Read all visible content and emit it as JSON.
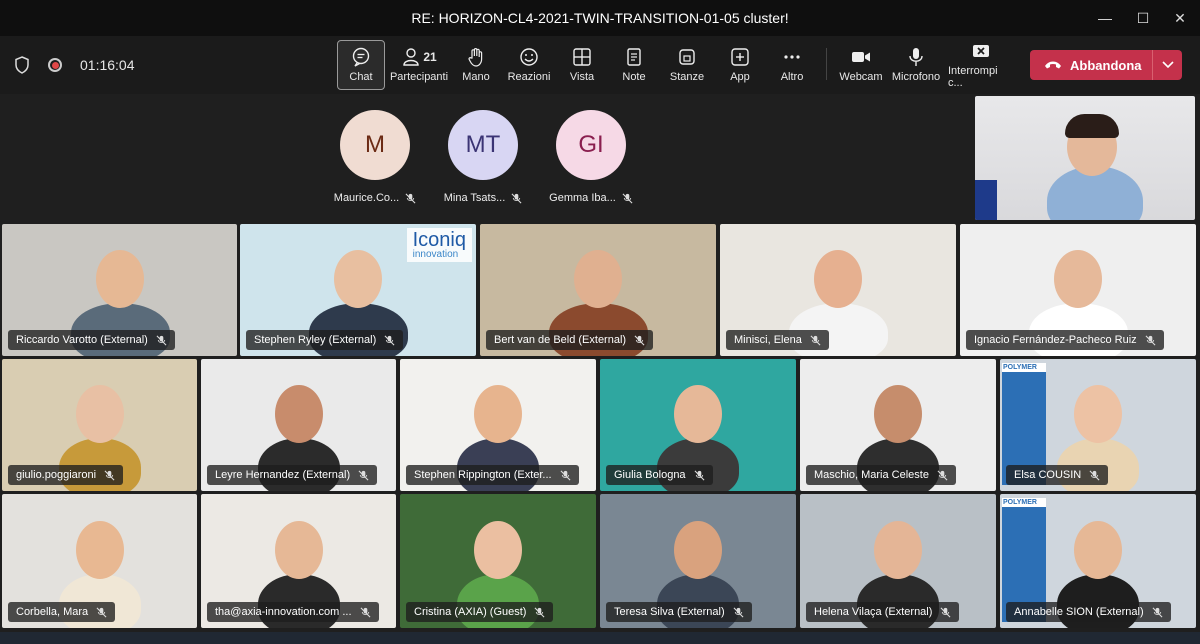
{
  "window": {
    "title": "RE: HORIZON-CL4-2021-TWIN-TRANSITION-01-05 cluster!"
  },
  "toolbar": {
    "timer": "01:16:04",
    "participants_count": "21",
    "buttons": [
      {
        "label": "Chat",
        "icon": "chat-icon"
      },
      {
        "label": "Partecipanti",
        "icon": "people-icon"
      },
      {
        "label": "Mano",
        "icon": "hand-icon"
      },
      {
        "label": "Reazioni",
        "icon": "smile-icon"
      },
      {
        "label": "Vista",
        "icon": "grid-icon"
      },
      {
        "label": "Note",
        "icon": "notes-icon"
      },
      {
        "label": "Stanze",
        "icon": "rooms-icon"
      },
      {
        "label": "App",
        "icon": "plus-icon"
      },
      {
        "label": "Altro",
        "icon": "more-icon"
      },
      {
        "label": "Webcam",
        "icon": "camera-icon"
      },
      {
        "label": "Microfono",
        "icon": "microphone-icon"
      },
      {
        "label": "Interrompi c...",
        "icon": "stop-share-icon"
      }
    ],
    "leave_label": "Abbandona"
  },
  "avatars": [
    {
      "initials": "M",
      "name": "Maurice.Co...",
      "bg": "#f0dcd2",
      "fg": "#6b2a14"
    },
    {
      "initials": "MT",
      "name": "Mina Tsats...",
      "bg": "#d8d6f3",
      "fg": "#3b3474"
    },
    {
      "initials": "GI",
      "name": "Gemma Iba...",
      "bg": "#f6d9e6",
      "fg": "#8a1f4f"
    }
  ],
  "participants": [
    "Riccardo Varotto (External)",
    "Stephen Ryley (External)",
    "Bert van de Beld (External)",
    "Minisci, Elena",
    "Ignacio Fernández-Pacheco Ruiz",
    "giulio.poggiaroni",
    "Leyre Hernandez (External)",
    "Stephen Rippington (Exter...",
    "Giulia Bologna",
    "Maschio, Maria Celeste",
    "Elsa COUSIN",
    "Corbella, Mara",
    "tha@axia-innovation.com ...",
    "Cristina (AXIA) (Guest)",
    "Teresa Silva (External)",
    "Helena Vilaça (External)",
    "Annabelle SION (External)"
  ],
  "tile_text": {
    "iconiq": "Iconiq",
    "iconiq_sub": "innovation",
    "polymer": "POLYMER"
  }
}
